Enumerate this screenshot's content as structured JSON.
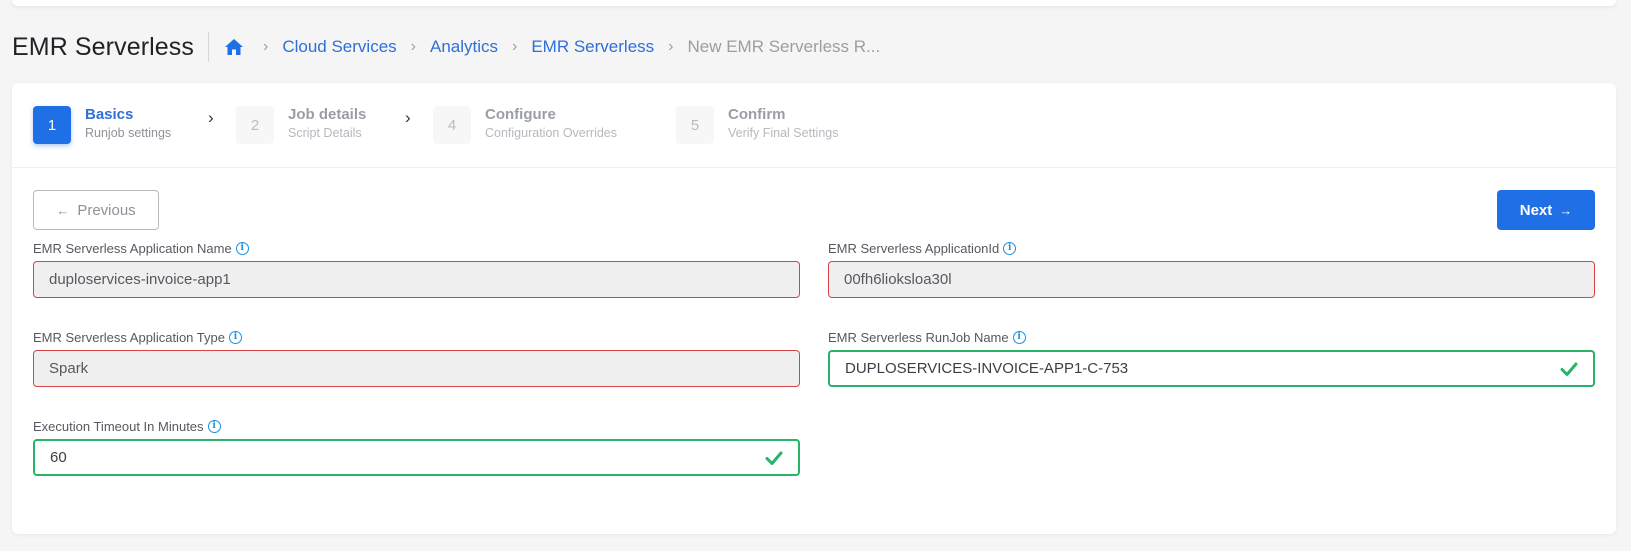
{
  "header": {
    "title": "EMR Serverless",
    "breadcrumbs": [
      {
        "label": "Cloud Services"
      },
      {
        "label": "Analytics"
      },
      {
        "label": "EMR Serverless"
      },
      {
        "label": "New EMR Serverless R..."
      }
    ]
  },
  "steps": [
    {
      "number": "1",
      "title": "Basics",
      "subtitle": "Runjob settings",
      "state": "active"
    },
    {
      "number": "2",
      "title": "Job details",
      "subtitle": "Script Details",
      "state": "inactive"
    },
    {
      "number": "4",
      "title": "Configure",
      "subtitle": "Configuration Overrides",
      "state": "inactive"
    },
    {
      "number": "5",
      "title": "Confirm",
      "subtitle": "Verify Final Settings",
      "state": "inactive"
    }
  ],
  "buttons": {
    "previous": "Previous",
    "next": "Next"
  },
  "fields": {
    "app_name": {
      "label": "EMR Serverless Application Name",
      "value": "duploservices-invoice-app1"
    },
    "app_id": {
      "label": "EMR Serverless ApplicationId",
      "value": "00fh6lioksloa30l"
    },
    "app_type": {
      "label": "EMR Serverless Application Type",
      "value": "Spark"
    },
    "runjob_name": {
      "label": "EMR Serverless RunJob Name",
      "value": "DUPLOSERVICES-INVOICE-APP1-C-753"
    },
    "timeout": {
      "label": "Execution Timeout In Minutes",
      "value": "60"
    }
  },
  "colors": {
    "primary": "#1f6fe6",
    "link": "#2f6fd6",
    "error_border": "#d64545",
    "valid_border": "#27b469"
  }
}
